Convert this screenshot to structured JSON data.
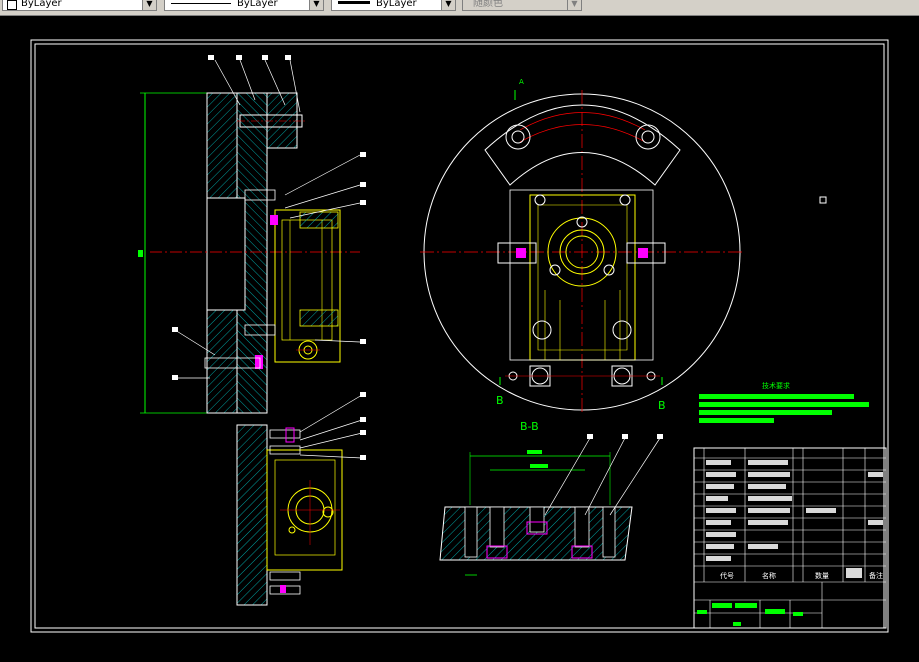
{
  "toolbar": {
    "color_combo": {
      "value": "ByLayer"
    },
    "linetype_combo": {
      "value": "ByLayer"
    },
    "lineweight_combo": {
      "value": "ByLayer"
    },
    "plotstyle_combo": {
      "value": "随颜色"
    }
  },
  "drawing": {
    "section_label": "B-B",
    "label_A": "A",
    "label_B_left": "B",
    "label_B_right": "B",
    "tech_requirements_title": "技术要求",
    "title_block": {
      "col_code": "代号",
      "col_name": "名称",
      "col_qty": "数量",
      "col_remark": "备注"
    },
    "colors": {
      "outline": "#ffffff",
      "center": "#ff0000",
      "part": "#ffff00",
      "hatch": "#00ffff",
      "dimension": "#00ff00",
      "bolt": "#ff00ff"
    }
  }
}
